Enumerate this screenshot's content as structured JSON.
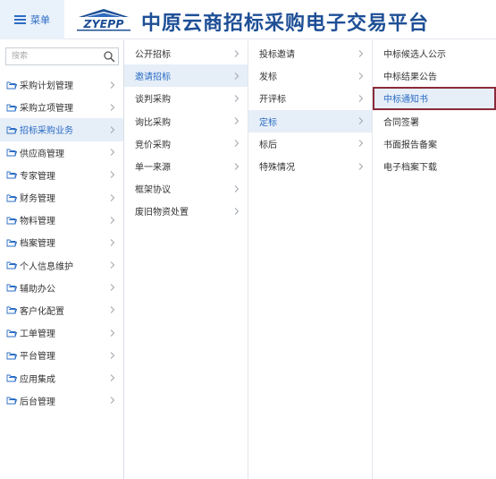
{
  "header": {
    "menu_label": "菜单",
    "logo_text": "ZYEPP",
    "title": "中原云商招标采购电子交易平台"
  },
  "search": {
    "placeholder": "搜索"
  },
  "sidebar": {
    "items": [
      {
        "label": "采购计划管理",
        "active": false
      },
      {
        "label": "采购立项管理",
        "active": false
      },
      {
        "label": "招标采购业务",
        "active": true
      },
      {
        "label": "供应商管理",
        "active": false
      },
      {
        "label": "专家管理",
        "active": false
      },
      {
        "label": "财务管理",
        "active": false
      },
      {
        "label": "物料管理",
        "active": false
      },
      {
        "label": "档案管理",
        "active": false
      },
      {
        "label": "个人信息维护",
        "active": false
      },
      {
        "label": "辅助办公",
        "active": false
      },
      {
        "label": "客户化配置",
        "active": false
      },
      {
        "label": "工单管理",
        "active": false
      },
      {
        "label": "平台管理",
        "active": false
      },
      {
        "label": "应用集成",
        "active": false
      },
      {
        "label": "后台管理",
        "active": false
      }
    ]
  },
  "level2": {
    "items": [
      {
        "label": "公开招标",
        "active": false
      },
      {
        "label": "邀请招标",
        "active": true
      },
      {
        "label": "谈判采购",
        "active": false
      },
      {
        "label": "询比采购",
        "active": false
      },
      {
        "label": "竞价采购",
        "active": false
      },
      {
        "label": "单一来源",
        "active": false
      },
      {
        "label": "框架协议",
        "active": false
      },
      {
        "label": "废旧物资处置",
        "active": false
      }
    ]
  },
  "level3": {
    "items": [
      {
        "label": "投标邀请",
        "active": false
      },
      {
        "label": "发标",
        "active": false
      },
      {
        "label": "开评标",
        "active": false
      },
      {
        "label": "定标",
        "active": true
      },
      {
        "label": "标后",
        "active": false
      },
      {
        "label": "特殊情况",
        "active": false
      }
    ]
  },
  "level4": {
    "items": [
      {
        "label": "中标候选人公示",
        "highlight": false
      },
      {
        "label": "中标结果公告",
        "highlight": false
      },
      {
        "label": "中标通知书",
        "highlight": true
      },
      {
        "label": "合同签署",
        "highlight": false
      },
      {
        "label": "书面报告备案",
        "highlight": false
      },
      {
        "label": "电子档案下载",
        "highlight": false
      }
    ]
  },
  "colors": {
    "brand": "#1e4f96",
    "accent": "#2b6cc4",
    "active_bg": "#e6eef8",
    "highlight_border": "#8a2b3a"
  }
}
